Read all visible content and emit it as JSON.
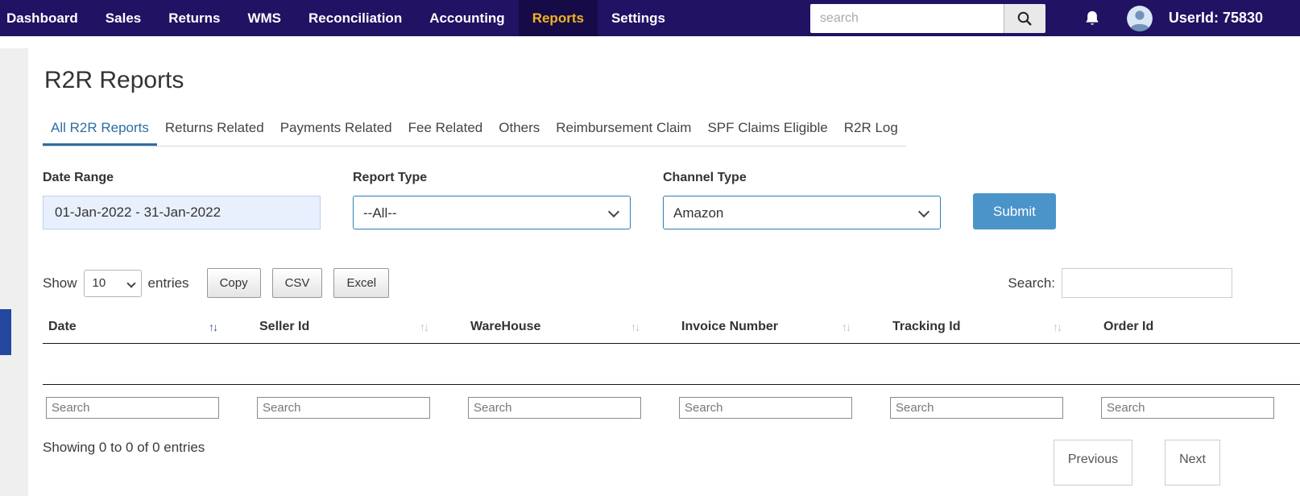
{
  "nav": {
    "items": [
      "Dashboard",
      "Sales",
      "Returns",
      "WMS",
      "Reconciliation",
      "Accounting",
      "Reports",
      "Settings"
    ],
    "active_item": "Reports",
    "search": {
      "placeholder": "search"
    },
    "user_id": "UserId: 75830"
  },
  "page": {
    "title": "R2R Reports",
    "tabs": [
      "All R2R Reports",
      "Returns Related",
      "Payments Related",
      "Fee Related",
      "Others",
      "Reimbursement Claim",
      "SPF Claims Eligible",
      "R2R Log"
    ],
    "active_tab": "All R2R Reports"
  },
  "filters": {
    "date_range": {
      "label": "Date Range",
      "value": "01-Jan-2022 - 31-Jan-2022"
    },
    "report_type": {
      "label": "Report Type",
      "value": "--All--"
    },
    "channel_type": {
      "label": "Channel Type",
      "value": "Amazon"
    },
    "submit_label": "Submit"
  },
  "table_controls": {
    "show_label": "Show",
    "entries_value": "10",
    "entries_label": "entries",
    "buttons": [
      "Copy",
      "CSV",
      "Excel"
    ],
    "search_label": "Search:"
  },
  "table": {
    "columns": [
      "Date",
      "Seller Id",
      "WareHouse",
      "Invoice Number",
      "Tracking Id",
      "Order Id"
    ],
    "sorted_column": "Date",
    "sort_glyph": "↑↓",
    "search_placeholder": "Search",
    "rows": []
  },
  "footer": {
    "showing_text": "Showing 0 to 0 of 0 entries",
    "previous_label": "Previous",
    "next_label": "Next"
  },
  "colors": {
    "nav_bg": "#211263",
    "nav_active_text": "#f0b41e",
    "tab_active": "#2e6da4",
    "select_border": "#2b7fb4",
    "date_input_bg": "#e8f0fe",
    "submit_bg": "#4b94c9",
    "accent_block": "#23479e"
  }
}
